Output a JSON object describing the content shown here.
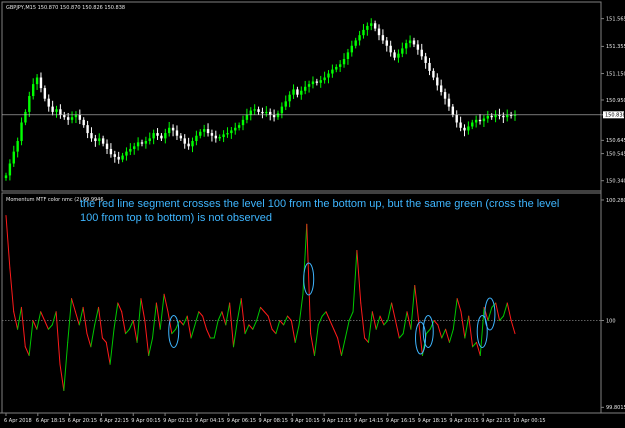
{
  "chart_data": [
    {
      "type": "candlestick",
      "title": "GBPJPY,M15  150.870 150.870 150.826 150.838",
      "price_axis_labels": [
        "151.565",
        "151.355",
        "151.150",
        "150.950",
        "150.838",
        "150.645",
        "150.545",
        "150.340"
      ],
      "current_price_label": "150.838",
      "colors": {
        "up": "#00ff00",
        "down": "#ffffff",
        "background": "#000000",
        "price_line": "#c0c0c0"
      },
      "closes": [
        150.38,
        150.47,
        150.56,
        150.64,
        150.78,
        150.86,
        150.98,
        151.07,
        151.12,
        151.04,
        150.96,
        150.9,
        150.86,
        150.88,
        150.84,
        150.82,
        150.8,
        150.82,
        150.84,
        150.8,
        150.76,
        150.7,
        150.66,
        150.64,
        150.66,
        150.62,
        150.58,
        150.54,
        150.52,
        150.5,
        150.53,
        150.56,
        150.58,
        150.6,
        150.63,
        150.62,
        150.64,
        150.66,
        150.7,
        150.68,
        150.66,
        150.7,
        150.74,
        150.72,
        150.68,
        150.66,
        150.62,
        150.6,
        150.64,
        150.68,
        150.71,
        150.73,
        150.7,
        150.68,
        150.66,
        150.67,
        150.69,
        150.7,
        150.72,
        150.74,
        150.76,
        150.8,
        150.84,
        150.87,
        150.88,
        150.86,
        150.85,
        150.86,
        150.84,
        150.82,
        150.85,
        150.9,
        150.94,
        150.99,
        151.03,
        150.99,
        151.02,
        151.05,
        151.07,
        151.09,
        151.08,
        151.1,
        151.12,
        151.15,
        151.18,
        151.2,
        151.22,
        151.26,
        151.31,
        151.36,
        151.4,
        151.44,
        151.48,
        151.51,
        151.53,
        151.49,
        151.44,
        151.4,
        151.36,
        151.31,
        151.27,
        151.3,
        151.34,
        151.38,
        151.4,
        151.37,
        151.33,
        151.28,
        151.23,
        151.17,
        151.12,
        151.06,
        151.01,
        150.96,
        150.9,
        150.84,
        150.78,
        150.74,
        150.72,
        150.75,
        150.78,
        150.8,
        150.79,
        150.81,
        150.83,
        150.82,
        150.84,
        150.83,
        150.82,
        150.84,
        150.83,
        150.84
      ]
    },
    {
      "type": "line",
      "title": "Momentum MTF color nmc (2) 99.9946",
      "price_axis_labels": [
        "100.2804",
        "100",
        "99.8015"
      ],
      "level": 100,
      "colors": {
        "rising": "#00c800",
        "falling": "#ff1a1a",
        "circle": "#3fb6ff",
        "level_line": "#808080"
      },
      "values": [
        100.24,
        100.12,
        100.02,
        99.98,
        100.03,
        99.94,
        99.92,
        100.0,
        99.98,
        100.02,
        100.0,
        99.98,
        99.99,
        100.02,
        99.9,
        99.84,
        99.95,
        100.05,
        100.02,
        99.99,
        100.03,
        99.97,
        99.94,
        99.99,
        100.03,
        99.96,
        99.95,
        99.9,
        99.98,
        100.04,
        100.02,
        99.97,
        99.98,
        100.0,
        99.95,
        100.05,
        100.0,
        99.92,
        99.96,
        100.04,
        99.98,
        100.06,
        100.02,
        99.97,
        99.98,
        100.0,
        99.99,
        100.01,
        99.96,
        99.99,
        100.02,
        100.01,
        99.98,
        99.96,
        99.96,
        100.0,
        100.02,
        99.99,
        100.04,
        99.94,
        100.0,
        100.05,
        99.97,
        99.99,
        99.98,
        100.0,
        100.03,
        100.02,
        100.01,
        99.98,
        99.97,
        100.0,
        99.99,
        100.01,
        100.0,
        99.95,
        99.99,
        100.06,
        100.22,
        99.97,
        99.92,
        99.99,
        100.01,
        100.02,
        100.0,
        99.98,
        99.96,
        99.92,
        99.96,
        100.0,
        100.02,
        100.16,
        100.04,
        99.96,
        99.95,
        100.02,
        99.98,
        100.01,
        99.99,
        100.0,
        100.04,
        100.0,
        99.96,
        99.97,
        100.02,
        99.98,
        100.08,
        100.0,
        99.92,
        99.97,
        99.98,
        100.0,
        99.99,
        99.96,
        99.98,
        99.95,
        99.98,
        100.05,
        100.02,
        99.96,
        100.01,
        99.94,
        99.95,
        99.92,
        100.03,
        100.0,
        100.03,
        100.04,
        100.0,
        100.01,
        100.04,
        100.0,
        99.97
      ]
    }
  ],
  "time_axis_labels": [
    "6 Apr 2018",
    "6 Apr 18:15",
    "6 Apr 20:15",
    "6 Apr 22:15",
    "9 Apr 00:15",
    "9 Apr 02:15",
    "9 Apr 04:15",
    "9 Apr 06:15",
    "9 Apr 08:15",
    "9 Apr 10:15",
    "9 Apr 12:15",
    "9 Apr 14:15",
    "9 Apr 16:15",
    "9 Apr 18:15",
    "9 Apr 20:15",
    "9 Apr 22:15",
    "10 Apr 00:15"
  ],
  "annotation": {
    "line1": "the red line segment crosses the level 100 from the bottom up, but the same green (cross the level",
    "line2": "100 from top to bottom) is not observed"
  },
  "highlight_circle_bars": [
    43,
    78,
    107,
    109,
    123,
    125
  ]
}
